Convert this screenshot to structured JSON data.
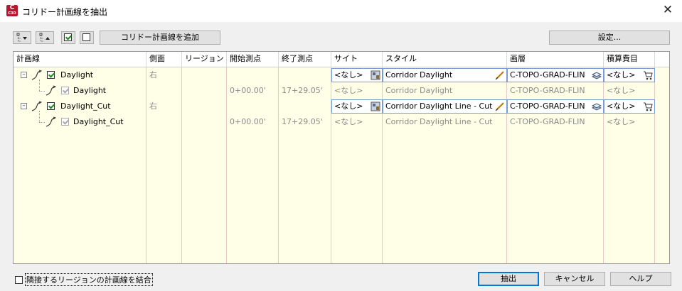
{
  "window": {
    "title": "コリドー計画線を抽出",
    "icon_text": "C",
    "icon_sub": "C3D"
  },
  "toolbar": {
    "add_button": "コリドー計画線を追加",
    "settings_button": "設定..."
  },
  "columns": [
    "計画線",
    "側面",
    "リージョン",
    "開始測点",
    "終了測点",
    "サイト",
    "スタイル",
    "画層",
    "積算費目"
  ],
  "rows": [
    {
      "level": 0,
      "name": "Daylight",
      "side": "右",
      "start": "",
      "end": "",
      "site": "<なし>",
      "style": "Corridor Daylight",
      "layer": "C-TOPO-GRAD-FLIN",
      "pay": "<なし>"
    },
    {
      "level": 1,
      "name": "Daylight",
      "side": "",
      "start": "0+00.00'",
      "end": "17+29.05'",
      "site": "<なし>",
      "style": "Corridor Daylight",
      "layer": "C-TOPO-GRAD-FLIN",
      "pay": "<なし>"
    },
    {
      "level": 0,
      "name": "Daylight_Cut",
      "side": "右",
      "start": "",
      "end": "",
      "site": "<なし>",
      "style": "Corridor Daylight Line - Cut",
      "layer": "C-TOPO-GRAD-FLIN",
      "pay": "<なし>"
    },
    {
      "level": 1,
      "name": "Daylight_Cut",
      "side": "",
      "start": "0+00.00'",
      "end": "17+29.05'",
      "site": "<なし>",
      "style": "Corridor Daylight Line - Cut",
      "layer": "C-TOPO-GRAD-FLIN",
      "pay": "<なし>"
    }
  ],
  "footer": {
    "merge_label": "隣接するリージョンの計画線を結合",
    "extract_button": "抽出",
    "cancel_button": "キャンセル",
    "help_button": "ヘルプ"
  },
  "icons": {
    "close": "close-icon",
    "expand_all": "expand-all-icon",
    "collapse_all": "collapse-all-icon",
    "check_all": "check-all-icon",
    "uncheck_all": "uncheck-all-icon"
  }
}
